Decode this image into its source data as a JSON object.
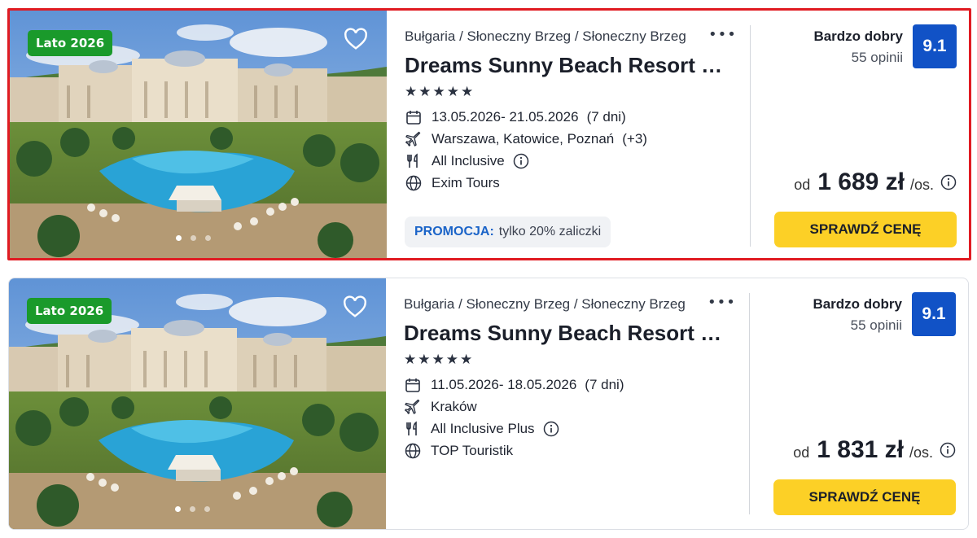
{
  "offers": [
    {
      "tag": "Lato 2026",
      "breadcrumb": "Bułgaria / Słoneczny Brzeg / Słoneczny Brzeg",
      "more": "•••",
      "hotel_name": "Dreams Sunny Beach Resort & Spa",
      "stars": "★★★★★",
      "dates": "13.05.2026- 21.05.2026",
      "duration": "(7 dni)",
      "departure": "Warszawa, Katowice, Poznań",
      "departure_extra": "(+3)",
      "board": "All Inclusive",
      "operator": "Exim Tours",
      "promo_label": "PROMOCJA:",
      "promo_text": "tylko 20% zaliczki",
      "rating_label": "Bardzo dobry",
      "reviews": "55 opinii",
      "score": "9.1",
      "price_prefix": "od",
      "price": "1 689 zł",
      "price_unit": "/os.",
      "cta": "SPRAWDŹ CENĘ"
    },
    {
      "tag": "Lato 2026",
      "breadcrumb": "Bułgaria / Słoneczny Brzeg / Słoneczny Brzeg",
      "more": "•••",
      "hotel_name": "Dreams Sunny Beach Resort & Spa",
      "stars": "★★★★★",
      "dates": "11.05.2026- 18.05.2026",
      "duration": "(7 dni)",
      "departure": "Kraków",
      "board": "All Inclusive Plus",
      "operator": "TOP Touristik",
      "rating_label": "Bardzo dobry",
      "reviews": "55 opinii",
      "score": "9.1",
      "price_prefix": "od",
      "price": "1 831 zł",
      "price_unit": "/os.",
      "cta": "SPRAWDŹ CENĘ"
    }
  ],
  "colors": {
    "tag_green": "#1a9a2b",
    "score_blue": "#1152c6",
    "cta_yellow": "#fcd026",
    "promo_blue": "#1b64c8",
    "selection_red": "#e01b22"
  }
}
